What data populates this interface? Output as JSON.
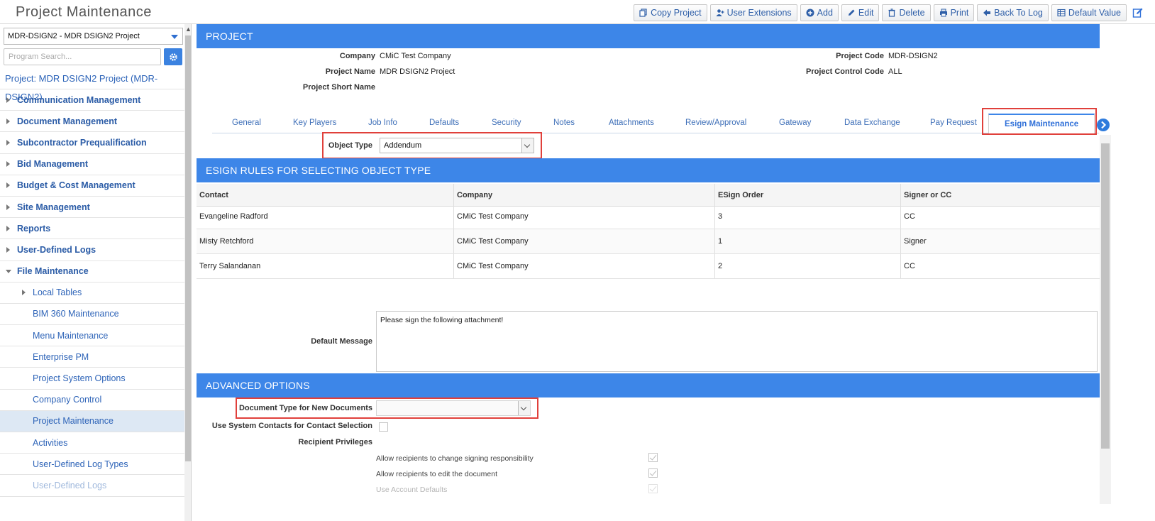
{
  "app": {
    "title": "Project Maintenance"
  },
  "toolbar": {
    "buttons": [
      {
        "label": "Copy Project",
        "icon": "copy-icon"
      },
      {
        "label": "User Extensions",
        "icon": "user-plus-icon"
      },
      {
        "label": "Add",
        "icon": "plus-circle-icon"
      },
      {
        "label": "Edit",
        "icon": "pencil-icon"
      },
      {
        "label": "Delete",
        "icon": "trash-icon"
      },
      {
        "label": "Print",
        "icon": "print-icon"
      },
      {
        "label": "Back To Log",
        "icon": "arrow-left-icon"
      },
      {
        "label": "Default Value",
        "icon": "table-icon"
      }
    ]
  },
  "sidebar": {
    "project_select": "MDR-DSIGN2 - MDR DSIGN2 Project",
    "search_placeholder": "Program Search...",
    "project_label": "Project: MDR DSIGN2 Project (MDR-DSIGN2)",
    "items": [
      {
        "label": "Communication Management",
        "level": "top",
        "state": "collapsed"
      },
      {
        "label": "Document Management",
        "level": "top",
        "state": "collapsed"
      },
      {
        "label": "Subcontractor Prequalification",
        "level": "top",
        "state": "collapsed"
      },
      {
        "label": "Bid Management",
        "level": "top",
        "state": "collapsed"
      },
      {
        "label": "Budget & Cost Management",
        "level": "top",
        "state": "collapsed"
      },
      {
        "label": "Site Management",
        "level": "top",
        "state": "collapsed"
      },
      {
        "label": "Reports",
        "level": "top",
        "state": "collapsed"
      },
      {
        "label": "User-Defined Logs",
        "level": "top",
        "state": "collapsed"
      },
      {
        "label": "File Maintenance",
        "level": "top",
        "state": "expanded"
      },
      {
        "label": "Local Tables",
        "level": "sub",
        "state": "collapsed"
      },
      {
        "label": "BIM 360 Maintenance",
        "level": "sub"
      },
      {
        "label": "Menu Maintenance",
        "level": "sub"
      },
      {
        "label": "Enterprise PM",
        "level": "sub"
      },
      {
        "label": "Project System Options",
        "level": "sub"
      },
      {
        "label": "Company Control",
        "level": "sub"
      },
      {
        "label": "Project Maintenance",
        "level": "sub",
        "active": true
      },
      {
        "label": "Activities",
        "level": "sub"
      },
      {
        "label": "User-Defined Log Types",
        "level": "sub"
      },
      {
        "label": "User-Defined Logs",
        "level": "sub",
        "faded": true
      }
    ]
  },
  "project": {
    "header": "PROJECT",
    "company_label": "Company",
    "company": "CMiC Test Company",
    "name_label": "Project Name",
    "name": "MDR DSIGN2 Project",
    "short_name_label": "Project Short Name",
    "short_name": "",
    "code_label": "Project Code",
    "code": "MDR-DSIGN2",
    "control_code_label": "Project Control Code",
    "control_code": "ALL"
  },
  "tabs": [
    "General",
    "Key Players",
    "Job Info",
    "Defaults",
    "Security",
    "Notes",
    "Attachments",
    "Review/Approval",
    "Gateway",
    "Data Exchange",
    "Pay Request",
    "Esign Maintenance"
  ],
  "active_tab": "Esign Maintenance",
  "object_type": {
    "label": "Object Type",
    "value": "Addendum"
  },
  "rules": {
    "header": "ESIGN RULES FOR SELECTING OBJECT TYPE",
    "columns": [
      "Contact",
      "Company",
      "ESign Order",
      "Signer or CC"
    ],
    "rows": [
      [
        "Evangeline Radford",
        "CMiC Test Company",
        "3",
        "CC"
      ],
      [
        "Misty Retchford",
        "CMiC Test Company",
        "1",
        "Signer"
      ],
      [
        "Terry Salandanan",
        "CMiC Test Company",
        "2",
        "CC"
      ]
    ]
  },
  "default_message": {
    "label": "Default Message",
    "value": "Please sign the following attachment!"
  },
  "advanced": {
    "header": "ADVANCED OPTIONS",
    "doc_type_label": "Document Type for New Documents",
    "doc_type_value": "",
    "system_contacts_label": "Use System Contacts for Contact Selection",
    "system_contacts_checked": false,
    "recipient_privileges_label": "Recipient Privileges",
    "privileges": [
      {
        "label": "Allow recipients to change signing responsibility",
        "checked": true
      },
      {
        "label": "Allow recipients to edit the document",
        "checked": true
      },
      {
        "label": "Use Account Defaults",
        "checked": true
      }
    ]
  },
  "colors": {
    "accent": "#3d86e8",
    "highlight": "#e0403b",
    "link": "#2a5ba6"
  }
}
